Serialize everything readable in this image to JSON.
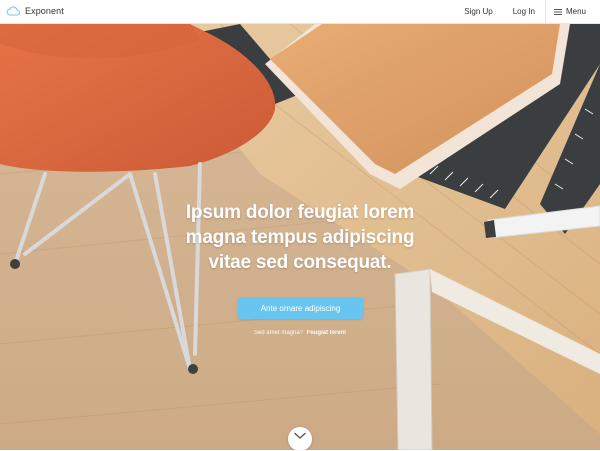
{
  "header": {
    "brand": "Exponent",
    "brand_icon": "cloud-icon",
    "nav": {
      "signup": "Sign Up",
      "login": "Log In",
      "menu": "Menu",
      "menu_icon": "hamburger-icon"
    }
  },
  "hero": {
    "headline_lines": [
      "Ipsum dolor feugiat lorem",
      "magna tempus adipiscing",
      "vitae sed consequat."
    ],
    "cta_label": "Ante ornare adipiscing",
    "sub_text": "Sed amet magna?",
    "sub_link": "Feugiat lorem",
    "scroll_icon": "chevron-down-icon"
  },
  "colors": {
    "accent": "#68c5ef",
    "header_bg": "#ffffff"
  }
}
